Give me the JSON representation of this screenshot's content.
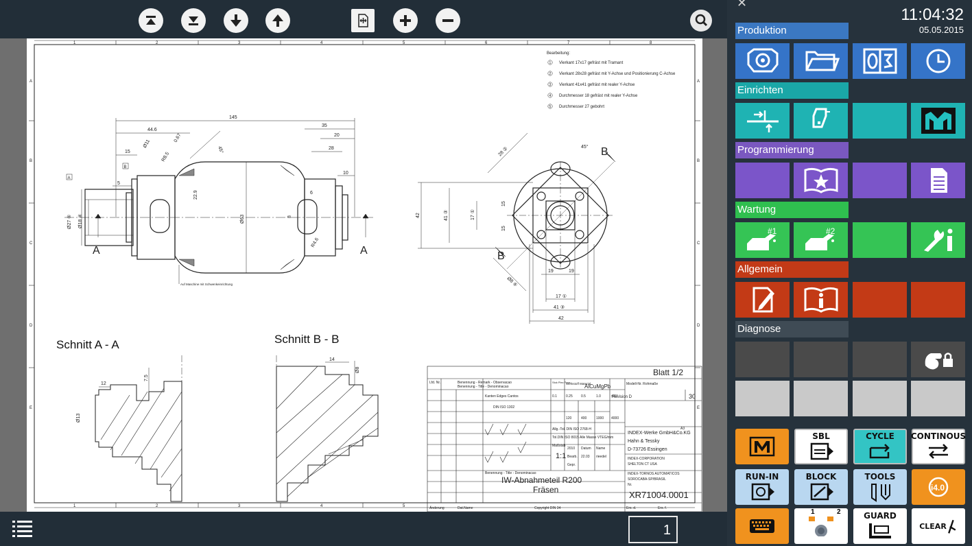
{
  "toolbar": {
    "buttons": [
      {
        "name": "first-page-icon"
      },
      {
        "name": "last-page-icon"
      },
      {
        "name": "next-page-icon"
      },
      {
        "name": "previous-page-icon"
      },
      {
        "name": "fit-page-icon"
      },
      {
        "name": "zoom-in-icon"
      },
      {
        "name": "zoom-out-icon"
      }
    ],
    "search_icon": "magnifier-icon"
  },
  "drawing": {
    "column_numbers": [
      "1",
      "2",
      "3",
      "4",
      "5",
      "6",
      "7",
      "8"
    ],
    "row_letters": [
      "A",
      "B",
      "C",
      "D",
      "E"
    ],
    "notes_title": "Bearbeitung:",
    "notes": [
      {
        "n": "1",
        "text": "Vierkant 17x17 gefräst mit Tramant"
      },
      {
        "n": "2",
        "text": "Vierkant 28x28 gefräst mit Y-Achse und Positionierung C-Achse"
      },
      {
        "n": "3",
        "text": "Vierkant 41x41 gefräst mit realer Y-Achse"
      },
      {
        "n": "4",
        "text": "Durchmesser 18 gefräst mit realer Y-Achse"
      },
      {
        "n": "5",
        "text": "Durchmesser 27 gebohrt"
      }
    ],
    "front_view": {
      "dims": {
        "overall": "145",
        "d446": "44.6",
        "d35": "35",
        "d20": "20",
        "d28": "28",
        "d15": "15",
        "d10": "10",
        "d5": "5",
        "d6": "6",
        "d8": "8",
        "dia11": "Ø11",
        "r85": "R8.5",
        "r46": "R4.6",
        "d067": "0.67",
        "a45": "45°",
        "d229": "22.9",
        "dia63": "Ø63",
        "dia27": "Ø27 ⑤",
        "dia18": "Ø18 ④"
      },
      "section_markers": [
        "A",
        "A"
      ],
      "flag_a": "A",
      "flag_b": "B",
      "note": "Auf Maschine mit Schwenkeinrichtung"
    },
    "side_view": {
      "dims": {
        "d42v": "42",
        "d41v": "41 ③",
        "d17v": "17 ①",
        "d15a": "15",
        "d15b": "15",
        "d19a": "19",
        "d19b": "19",
        "d17h": "17 ①",
        "d41h": "41 ③",
        "d42h": "42",
        "d282": "28 ②",
        "dia8": "Ø8 ④",
        "a45": "45°"
      },
      "section_markers": [
        "B",
        "B"
      ]
    },
    "section_a": {
      "title": "Schnitt A - A",
      "dims": {
        "d12": "12",
        "d75": "7.5",
        "dia13": "Ø13"
      }
    },
    "section_b": {
      "title": "Schnitt B - B",
      "dims": {
        "d14": "14",
        "dia8": "Ø8"
      }
    },
    "title_block": {
      "sheet": "Blatt 1/2",
      "col_lfd": "Lfd. Nr.",
      "col_benennung": "Benennung - Remark - Observacao",
      "col_benennung2": "Benennung - Title - Denominacao",
      "col_stk": "Stck Piec Pecs",
      "col_werkstoff": "Werkstoff Material",
      "werkstoff": "AlCuMgPb",
      "col_modell": "Modell-Nr. Rohmaße",
      "kanten": "Kanten Edges Cantos",
      "din": "DIN ISO 1302",
      "revision": "Revision D",
      "scale_label": "Maßstab",
      "scale": "1:1",
      "company": [
        "INDEX-Werke GmbH&Co.KG",
        "Hahn & Tessky",
        "D-73726 Essingen"
      ],
      "corp": [
        "INDEX-CORPORATION",
        "SHELTON CT USA"
      ],
      "brasil": [
        "INDEX-TORNOS AUTOMATICOS",
        "SOROCABA-SP/BRASIL"
      ],
      "title_label": "Benennung - Title - Denominacao",
      "title1": "IW-Abnahmeteil R200",
      "title2": "Fräsen",
      "nr_label": "Nr.",
      "drawing_no": "XR71004.0001",
      "aenderung": "Änderung",
      "datum": "Dat.Name",
      "copyright": "Copyright DIN 34",
      "ers": "Ers. d.",
      "ers2": "Ers. f.",
      "size": "A3",
      "tolerances": [
        "0.1",
        "0.25",
        "0.5",
        "1.0",
        "±45°"
      ],
      "row2": [
        "120",
        "400",
        "1000",
        "4000"
      ],
      "allg_tol": "Allg.-Tol. DIN ISO 2768-H",
      "tol_iso": "Tol.DIN ISO 8015",
      "date1": "2010",
      "datum_col": "Datum",
      "name_col": "Name",
      "bearb": "Bearb.",
      "gepr": "Gepr.",
      "date2": "22.03",
      "name2": "rieedel",
      "alle_masse": "Alle Masse VTEG/mm",
      "ersatz": "30"
    }
  },
  "bottom": {
    "page": "1",
    "menu_icon": "list-icon"
  },
  "panel": {
    "time": "11:04:32",
    "date": "05.05.2015",
    "close_icon": "close-icon",
    "categories": [
      {
        "label": "Produktion",
        "color": "#3b78c2",
        "tile_color": "#3574c8",
        "tiles": [
          "gear-workpiece-icon",
          "folder-icon",
          "counter-icon",
          "clock-icon"
        ]
      },
      {
        "label": "Einrichten",
        "color": "#1aa7a7",
        "tile_color": "#1fb3b3",
        "tiles": [
          "tool-setup-icon",
          "tool-holder-icon",
          "",
          "m-logo-icon"
        ]
      },
      {
        "label": "Programmierung",
        "color": "#7a58c0",
        "tile_color": "#7b55c9",
        "tiles": [
          "",
          "book-star-icon",
          "",
          "document-icon"
        ]
      },
      {
        "label": "Wartung",
        "color": "#2fbf4f",
        "tile_color": "#35c455",
        "tiles": [
          "oil-can-1-icon",
          "oil-can-2-icon",
          "",
          "wrench-info-icon"
        ]
      },
      {
        "label": "Allgemein",
        "color": "#c23a17",
        "tile_color": "#c33a16",
        "tiles": [
          "edit-document-icon",
          "info-book-icon",
          "",
          ""
        ]
      },
      {
        "label": "Diagnose",
        "color": "#3f4b55",
        "tile_color": "#4a4a4a",
        "tiles": [
          "",
          "",
          "",
          "hand-lock-icon"
        ]
      }
    ],
    "extra_row_color": "#c9c9c9",
    "control_buttons": [
      {
        "label": "",
        "name": "m-function-button",
        "icon": "m-function-icon",
        "style": "orange"
      },
      {
        "label": "SBL",
        "name": "sbl-button",
        "icon": "single-block-icon",
        "style": "white"
      },
      {
        "label": "CYCLE",
        "name": "cycle-button",
        "icon": "cycle-icon",
        "style": "teal"
      },
      {
        "label": "CONTINOUS",
        "name": "continous-button",
        "icon": "continous-icon",
        "style": "white"
      },
      {
        "label": "RUN-IN",
        "name": "run-in-button",
        "icon": "run-in-icon",
        "style": "lblue"
      },
      {
        "label": "BLOCK",
        "name": "block-button",
        "icon": "block-icon",
        "style": "lblue"
      },
      {
        "label": "TOOLS",
        "name": "tools-button",
        "icon": "tools-icon",
        "style": "lblue"
      },
      {
        "label": "i4.0",
        "name": "i40-button",
        "icon": "i40-icon",
        "style": "orange"
      },
      {
        "label": "",
        "name": "keyboard-button",
        "icon": "keyboard-icon",
        "style": "orange"
      },
      {
        "label": "",
        "name": "override-knob-button",
        "icon": "knob-icon",
        "style": "white"
      },
      {
        "label": "GUARD",
        "name": "guard-button",
        "icon": "guard-icon",
        "style": "white"
      },
      {
        "label": "CLEAR",
        "name": "clear-button",
        "icon": "clear-icon",
        "style": "white"
      }
    ],
    "knob_labels": [
      "1",
      "2"
    ]
  }
}
